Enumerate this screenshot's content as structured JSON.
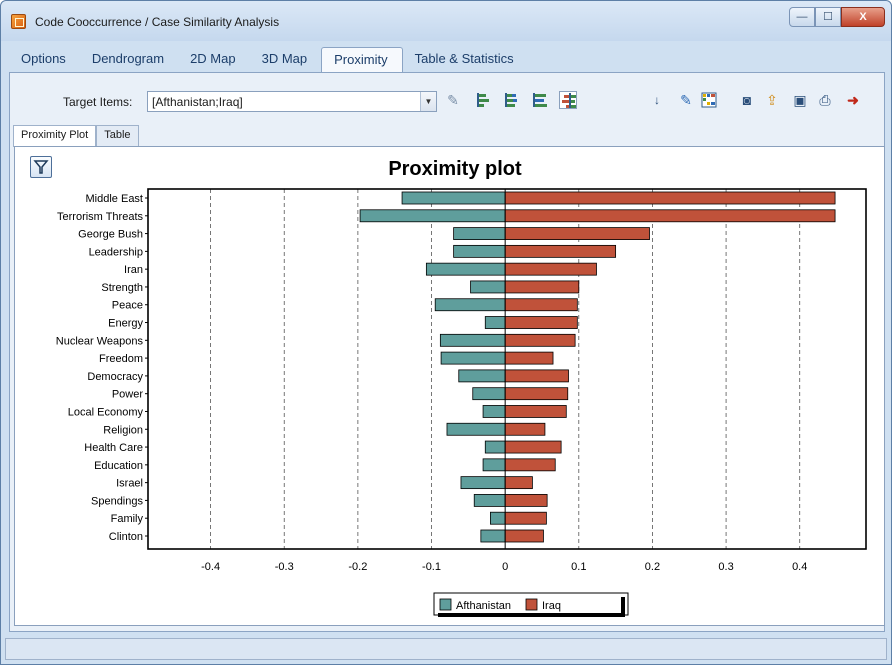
{
  "window": {
    "title": "Code Cooccurrence / Case Similarity Analysis"
  },
  "controls": {
    "minimize": "—",
    "maximize": "☐",
    "close": "X"
  },
  "menu_tabs": [
    "Options",
    "Dendrogram",
    "2D Map",
    "3D Map",
    "Proximity",
    "Table & Statistics"
  ],
  "active_menu_tab": "Proximity",
  "toolbar": {
    "target_label": "Target Items:",
    "target_value": "[Afthanistan;Iraq]"
  },
  "sub_tabs": [
    "Proximity Plot",
    "Table"
  ],
  "icons": [
    "filter-icon",
    "eraser-icon",
    "bar-chart-icon",
    "sort-icon",
    "chart-settings-icon",
    "grid-icon",
    "camera-icon",
    "export-icon",
    "save-icon",
    "print-icon",
    "exit-icon"
  ],
  "colors": {
    "afghanistan": "#5f9e9c",
    "iraq": "#c0523a"
  },
  "chart_data": {
    "type": "bar",
    "orientation": "horizontal",
    "title": "Proximity plot",
    "categories": [
      "Middle East",
      "Terrorism Threats",
      "George Bush",
      "Leadership",
      "Iran",
      "Strength",
      "Peace",
      "Energy",
      "Nuclear Weapons",
      "Freedom",
      "Democracy",
      "Power",
      "Local Economy",
      "Religion",
      "Health Care",
      "Education",
      "Israel",
      "Spendings",
      "Family",
      "Clinton"
    ],
    "series": [
      {
        "name": "Afthanistan",
        "values": [
          -0.14,
          -0.197,
          -0.07,
          -0.07,
          -0.107,
          -0.047,
          -0.095,
          -0.027,
          -0.088,
          -0.087,
          -0.063,
          -0.044,
          -0.03,
          -0.079,
          -0.027,
          -0.03,
          -0.06,
          -0.042,
          -0.02,
          -0.033
        ]
      },
      {
        "name": "Iraq",
        "values": [
          0.448,
          0.448,
          0.196,
          0.15,
          0.124,
          0.1,
          0.098,
          0.098,
          0.095,
          0.065,
          0.086,
          0.085,
          0.083,
          0.054,
          0.076,
          0.068,
          0.037,
          0.057,
          0.056,
          0.052
        ]
      }
    ],
    "x_ticks": [
      "-0.4",
      "-0.3",
      "-0.2",
      "-0.1",
      "0",
      "0.1",
      "0.2",
      "0.3",
      "0.4"
    ],
    "xlim": [
      -0.485,
      0.49
    ],
    "grid": true,
    "legend": "bottom"
  },
  "status": {
    "text": ""
  }
}
